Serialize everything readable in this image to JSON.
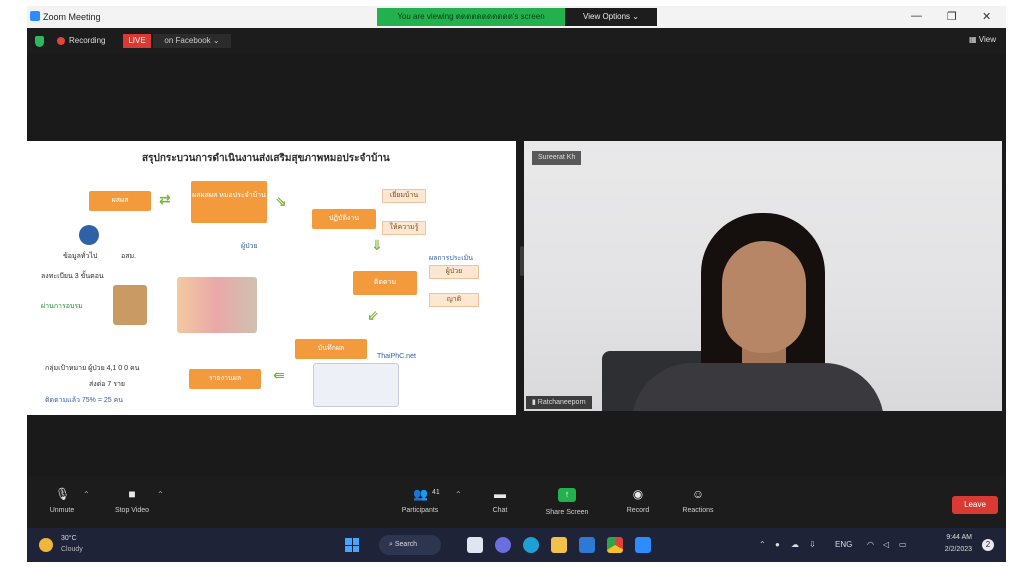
{
  "window": {
    "title": "Zoom Meeting",
    "share_banner": "You are viewing ดดดดดดดดดดด's screen",
    "view_options": "View Options ⌄",
    "minimize": "—",
    "maximize": "❐",
    "close": "✕"
  },
  "meeting_bar": {
    "recording_label": "Recording",
    "live_badge": "LIVE",
    "live_target": "on Facebook ⌄",
    "view_label": "View"
  },
  "slide": {
    "title": "สรุปกระบวนการดำเนินงานส่งเสริมสุขภาพหมอประจำบ้าน",
    "boxes": {
      "b1": "ผสผส",
      "b2": "ผสผสผส หมอประจำบ้าน",
      "b3": "ปฏิบัติงาน",
      "b4": "ติดตาม",
      "b5": "บันทึกผล",
      "b6": "รายงานผล"
    },
    "pills": {
      "p1": "เยี่ยมบ้าน",
      "p2": "ให้ความรู้",
      "p3": "ผู้ป่วย",
      "p4": "ญาติ"
    },
    "texts": {
      "t1": "ข้อมูลทั่วไป",
      "t2": "อสม.",
      "t3": "ผู้ป่วย",
      "t4": "ผลการประเมิน",
      "t5": "ThaiPhC.net",
      "t6": "กลุ่มเป้าหมาย ผู้ป่วย 4,1 0 0 คน",
      "t7": "ส่งต่อ 7 ราย",
      "t8": "ติดตามแล้ว 75% = 25 คน",
      "t9": "ลงทะเบียน 3 ขั้นตอน",
      "t10": "ผ่านการอบรม"
    }
  },
  "participant": {
    "top_name": "Sureerat Kh",
    "bottom_name": "Ratchaneeporn"
  },
  "toolbar": {
    "unmute": "Unmute",
    "stop_video": "Stop Video",
    "participants": "Participants",
    "participant_count": "41",
    "chat": "Chat",
    "share_screen": "Share Screen",
    "record": "Record",
    "reactions": "Reactions",
    "leave": "Leave"
  },
  "taskbar": {
    "weather_temp": "30°C",
    "weather_desc": "Cloudy",
    "search_label": "Search",
    "lang": "ENG",
    "time": "9:44 AM",
    "date": "2/2/2023",
    "notifications": "2"
  },
  "colors": {
    "accent_green": "#23b14d",
    "live_red": "#d93a33",
    "slide_orange": "#f39a3c",
    "taskbar": "#1e2337"
  }
}
